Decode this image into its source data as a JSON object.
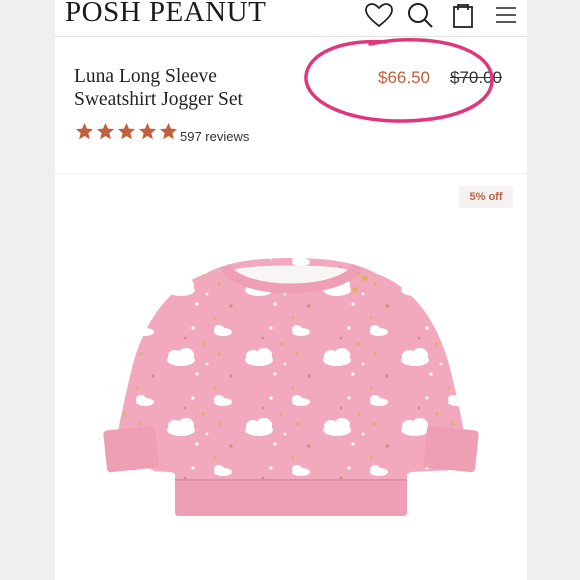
{
  "header": {
    "logo": "POSH PEANUT",
    "icons": [
      "heart-icon",
      "search-icon",
      "bag-icon",
      "menu-icon"
    ]
  },
  "product": {
    "title": "Luna Long Sleeve Sweatshirt Jogger Set",
    "sale_price": "$66.50",
    "original_price": "$70.00",
    "rating": 5,
    "reviews": "597 reviews",
    "discount_badge": "5% off"
  },
  "colors": {
    "accent": "#c2603d",
    "annotation": "#e0367e",
    "sweatshirt_pink": "#f2a8bd",
    "moon_gold": "#e0b060"
  }
}
